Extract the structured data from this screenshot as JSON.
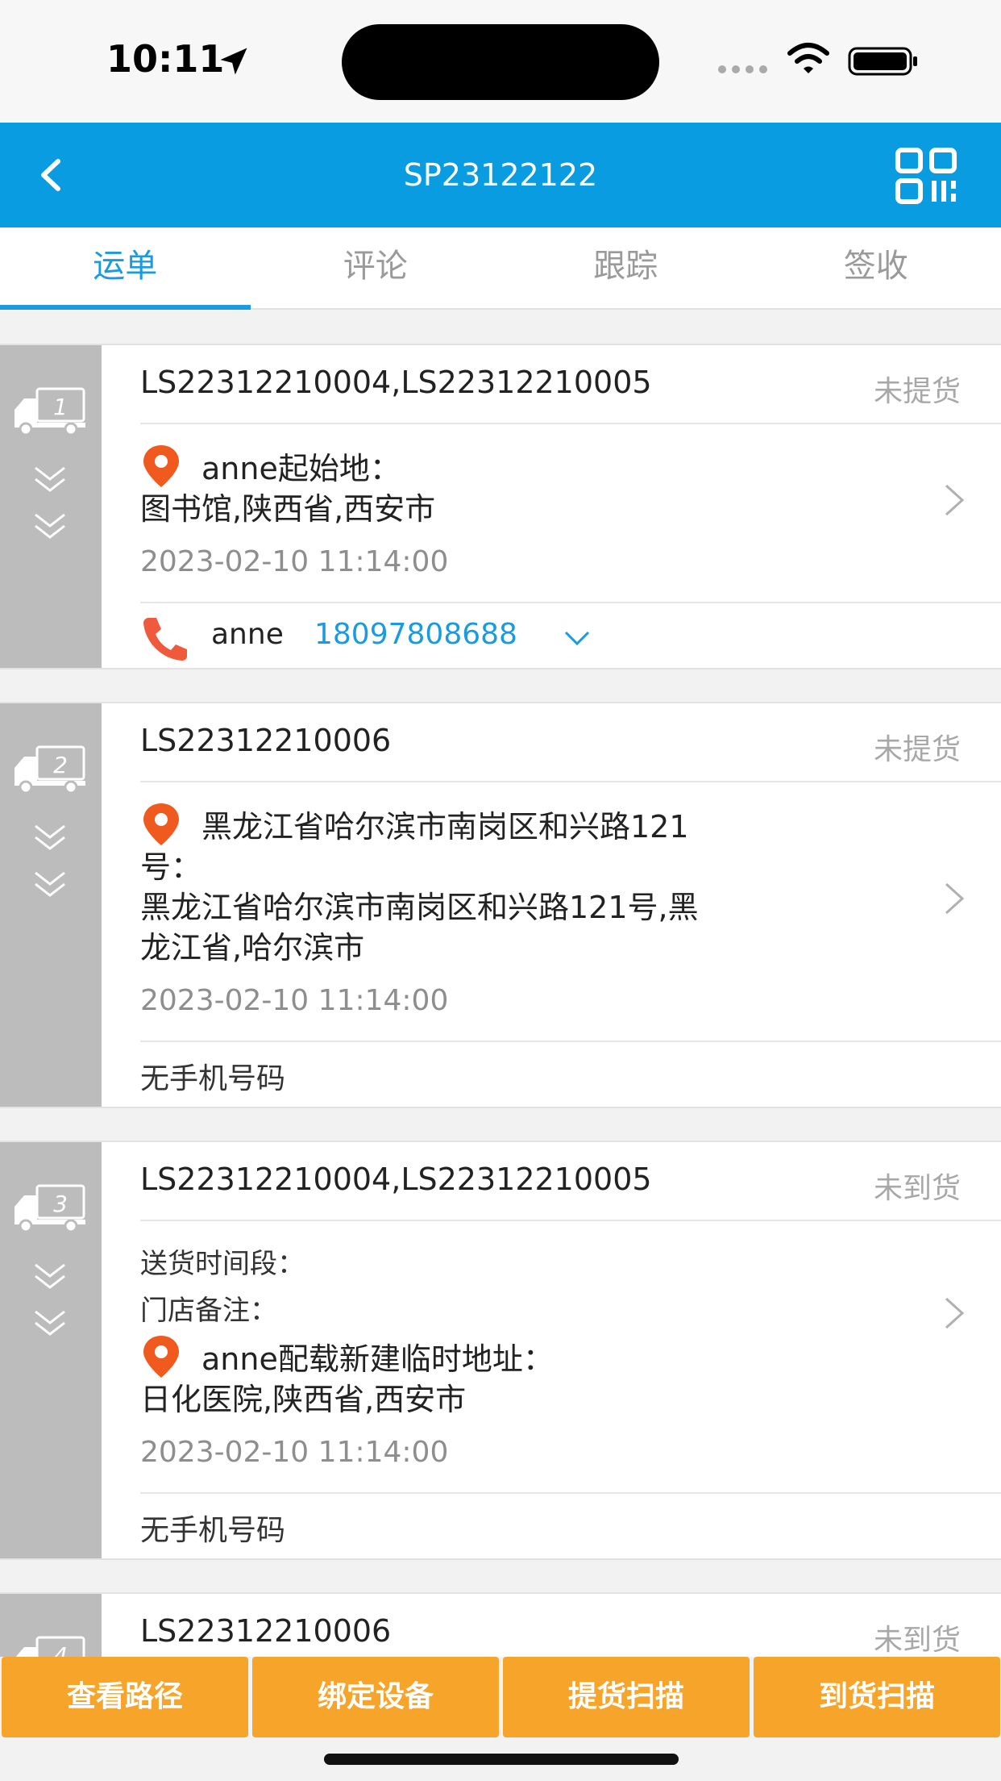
{
  "status_bar": {
    "time": "10:11"
  },
  "nav": {
    "title": "SP23122122"
  },
  "tabs": [
    {
      "label": "运单",
      "active": true
    },
    {
      "label": "评论",
      "active": false
    },
    {
      "label": "跟踪",
      "active": false
    },
    {
      "label": "签收",
      "active": false
    }
  ],
  "cards": [
    {
      "index": "1",
      "order_no": "LS22312210004,LS22312210005",
      "status": "未提货",
      "address_title": "anne起始地：",
      "address_detail": "图书馆,陕西省,西安市",
      "time": "2023-02-10 11:14:00",
      "contact_name": "anne",
      "contact_phone": "18097808688"
    },
    {
      "index": "2",
      "order_no": "LS22312210006",
      "status": "未提货",
      "address_title": "黑龙江省哈尔滨市南岗区和兴路121",
      "address_title_2": "号：",
      "address_detail": "黑龙江省哈尔滨市南岗区和兴路121号,黑",
      "address_detail_2": "龙江省,哈尔滨市",
      "time": "2023-02-10 11:14:00",
      "no_phone": "无手机号码"
    },
    {
      "index": "3",
      "order_no": "LS22312210004,LS22312210005",
      "status": "未到货",
      "delivery_period": "送货时间段：",
      "store_note": "门店备注：",
      "address_title": "anne配载新建临时地址：",
      "address_detail": "日化医院,陕西省,西安市",
      "time": "2023-02-10 11:14:00",
      "no_phone": "无手机号码"
    },
    {
      "index": "4",
      "order_no": "LS22312210006",
      "status": "未到货"
    }
  ],
  "actions": [
    {
      "label": "查看路径"
    },
    {
      "label": "绑定设备"
    },
    {
      "label": "提货扫描"
    },
    {
      "label": "到货扫描"
    }
  ],
  "colors": {
    "primary": "#0a9ce0",
    "link": "#1a9be0",
    "action": "#f7a52a",
    "pin": "#f05a1e",
    "side": "#bcbcbc"
  }
}
